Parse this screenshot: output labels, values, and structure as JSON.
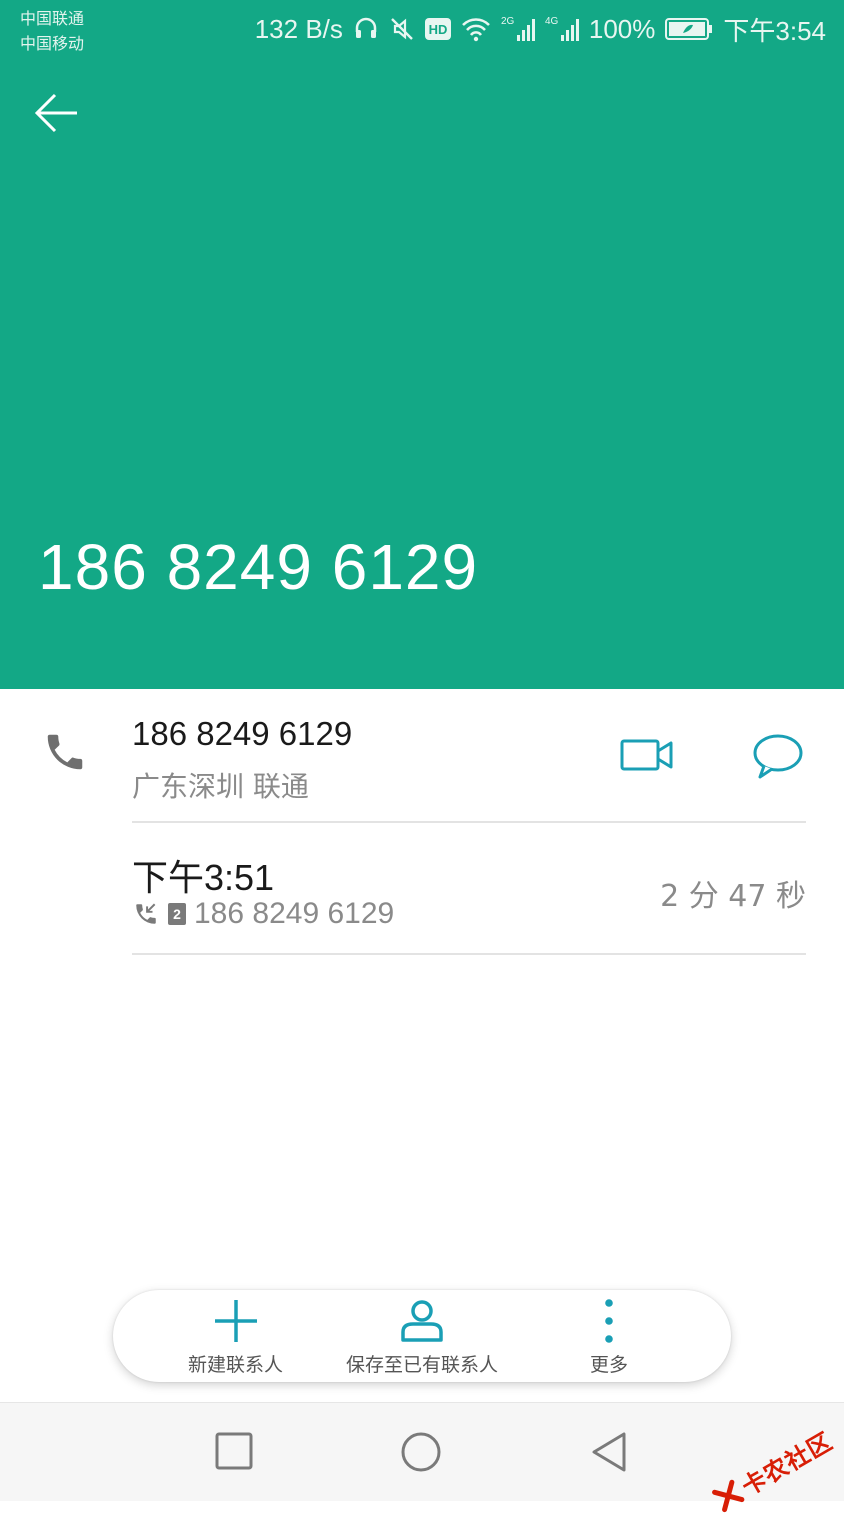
{
  "status_bar": {
    "carrier1": "中国联通",
    "carrier2": "中国移动",
    "network_speed": "132 B/s",
    "hd_badge": "HD",
    "signal1_tag": "2G",
    "signal2_tag": "4G",
    "battery": "100%",
    "time": "下午3:54",
    "icons": [
      "headset-icon",
      "mute-icon",
      "hd-icon",
      "wifi-icon",
      "signal-icon",
      "battery-icon"
    ]
  },
  "header": {
    "title_number": "186 8249 6129",
    "color": "#13a886"
  },
  "contact": {
    "number": "186 8249 6129",
    "location": "广东深圳 联通"
  },
  "call_log": [
    {
      "time": "下午3:51",
      "sim": "2",
      "number": "186 8249 6129",
      "duration": "2 分 47 秒"
    }
  ],
  "actions": {
    "new_contact": "新建联系人",
    "save_existing": "保存至已有联系人",
    "more": "更多"
  },
  "accent_color": "#1a9fb5",
  "watermark": "卡农社区"
}
